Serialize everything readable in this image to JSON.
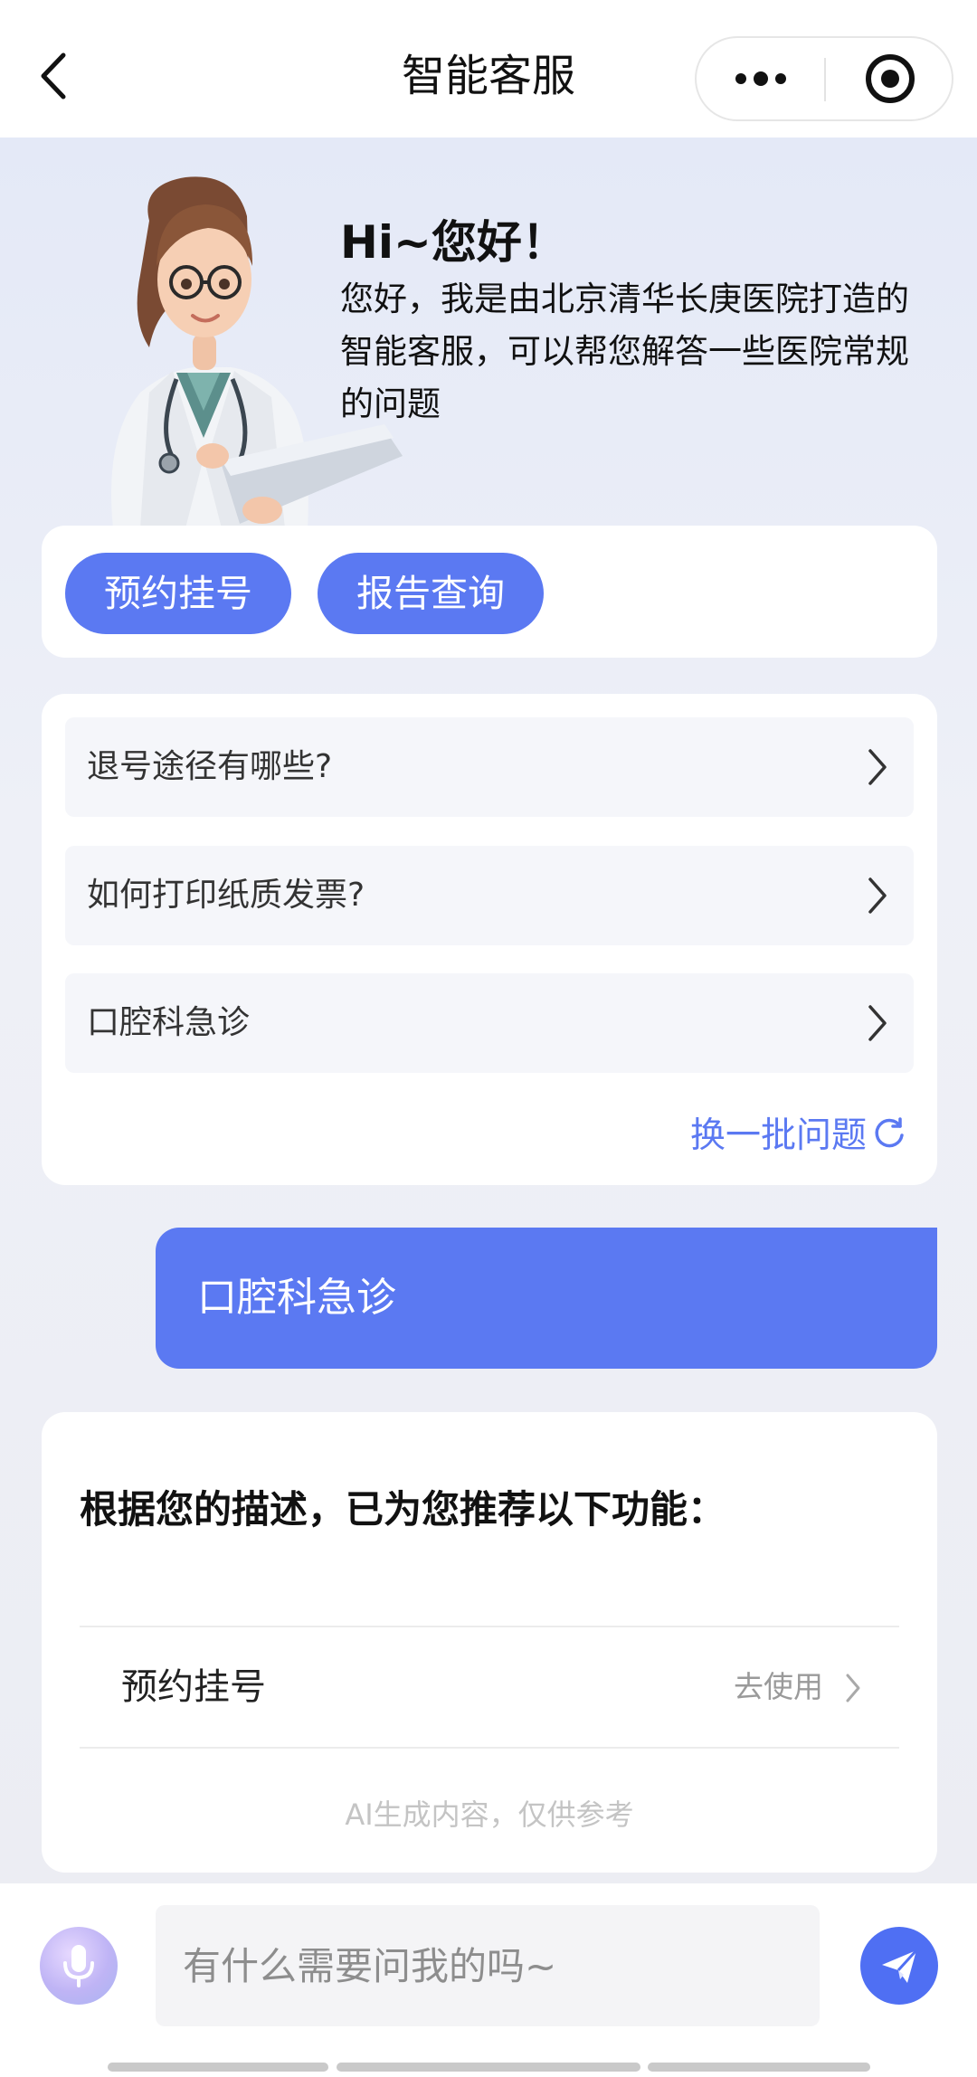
{
  "header": {
    "title": "智能客服",
    "back_icon": "chevron-left-icon",
    "more_icon": "more-dots-icon",
    "close_icon": "target-close-icon"
  },
  "greeting": {
    "title": "Hi~您好！",
    "text": "您好，我是由北京清华长庚医院打造的智能客服，可以帮您解答一些医院常规的问题"
  },
  "quick_actions": [
    {
      "label": "预约挂号"
    },
    {
      "label": "报告查询"
    }
  ],
  "faq": {
    "items": [
      {
        "label": "退号途径有哪些?"
      },
      {
        "label": "如何打印纸质发票?"
      },
      {
        "label": "口腔科急诊"
      }
    ],
    "refresh_label": "换一批问题"
  },
  "user_message": "口腔科急诊",
  "recommendation": {
    "title": "根据您的描述，已为您推荐以下功能：",
    "item_label": "预约挂号",
    "item_action": "去使用",
    "ai_note": "AI生成内容，仅供参考"
  },
  "input": {
    "placeholder": "有什么需要问我的吗~"
  },
  "colors": {
    "accent": "#5b79f2",
    "send": "#4f6ff3",
    "background": "#eef1f8"
  }
}
